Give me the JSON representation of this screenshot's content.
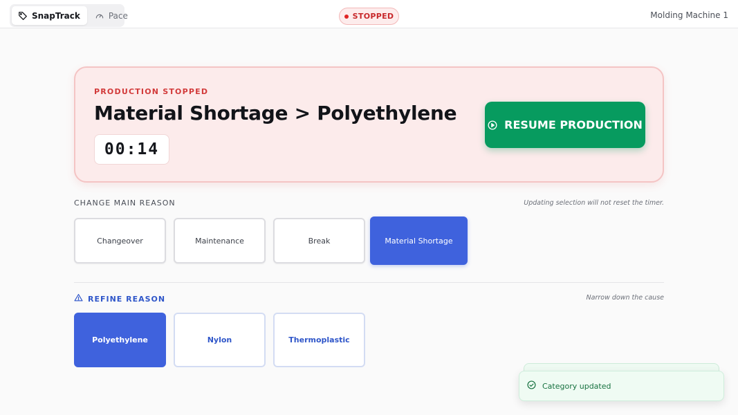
{
  "header": {
    "tabs": [
      {
        "label": "SnapTrack",
        "icon": "tag-icon",
        "active": true
      },
      {
        "label": "Pace",
        "icon": "gauge-icon",
        "active": false
      }
    ],
    "status": "STOPPED",
    "machine": "Molding Machine 1"
  },
  "banner": {
    "label": "PRODUCTION STOPPED",
    "title": "Material Shortage > Polyethylene",
    "timer": "00:14",
    "resume_label": "RESUME PRODUCTION"
  },
  "main_reason": {
    "heading": "CHANGE MAIN REASON",
    "hint": "Updating selection will not reset the timer.",
    "options": [
      "Changeover",
      "Maintenance",
      "Break",
      "Material Shortage"
    ],
    "selected": "Material Shortage"
  },
  "refine": {
    "heading": "REFINE REASON",
    "hint": "Narrow down the cause",
    "options": [
      "Polyethylene",
      "Nylon",
      "Thermoplastic"
    ],
    "selected": "Polyethylene"
  },
  "toast": {
    "message": "Category updated"
  },
  "colors": {
    "accent_blue": "#3f62dd",
    "stopped_red": "#d23a3a",
    "resume_green": "#079b5f",
    "toast_green": "#16713f"
  }
}
